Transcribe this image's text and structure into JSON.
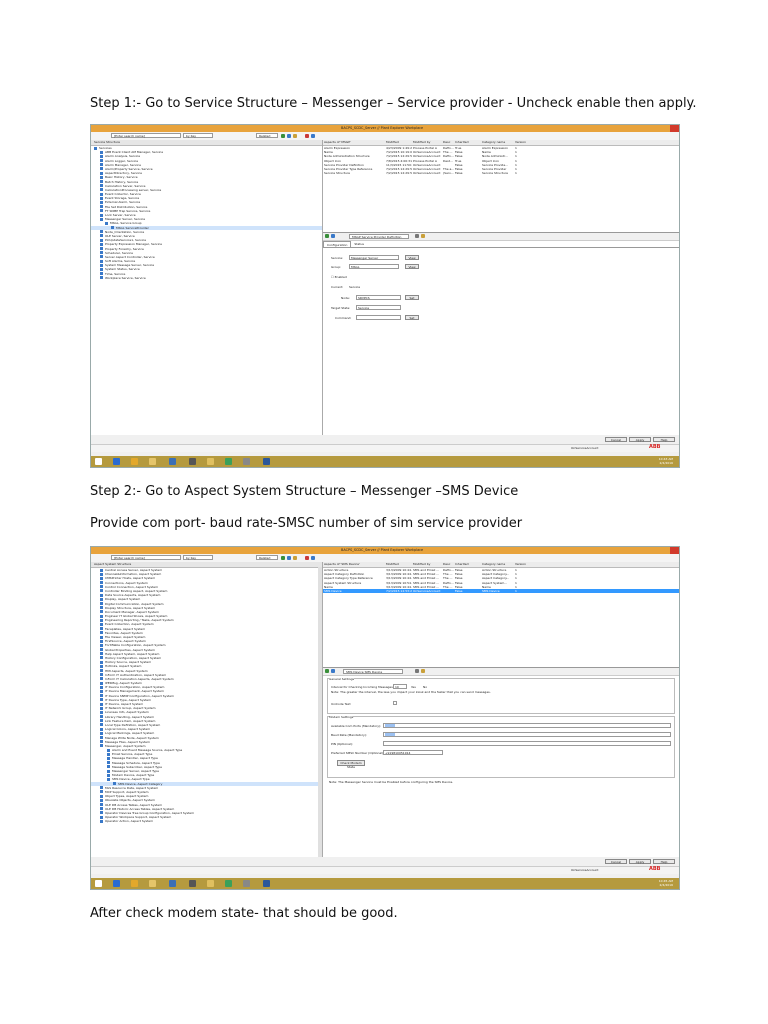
{
  "step1": "Step 1:- Go to Service Structure – Messenger – Service provider - Uncheck enable then apply.",
  "step2": "Step 2:- Go to Aspect System Structure – Messenger –SMS Device",
  "provide": "Provide com port- baud rate-SMSC number of sim service provider",
  "after": "After check modem state- that should be good.",
  "shot1": {
    "title": "BACPS_SCDC_Server // Plant Explorer Workplace",
    "search_placeholder": "[Enter search name]",
    "search_scope": "by Key",
    "filter": "Related",
    "tree_header": "Service Structure",
    "tree": [
      "Services",
      "ABB Event Client AM Manager, Service",
      "Alarm Analysis, Service",
      "Alarm Logger, Service",
      "Alarm Manager, Service",
      "Alarm/Property Service, Service",
      "AspectDirectory, Service",
      "Basic History, Service",
      "Batch History, Service",
      "Calculation Server, Service",
      "CalculationProcessing server, Service",
      "Event Collector, Service",
      "Event Storage, Service",
      "External Alarm, Service",
      "File Set Distribution, Service",
      "FT SNMP Trap Service, Service",
      "Lock Server, Service",
      "Messenger Server, Service",
      "MSGL, Service Group",
      "MSGL ServiceProvider",
      "Node_Orientation, Service",
      "OLE Server, Service",
      "PlcUpdateService1, Service",
      "Property Expression Manager, Service",
      "Property Forestry, Service",
      "Scheduler, Service",
      "Server Aspect Controller, Service",
      "Soft Alarms, Service",
      "System Message Server, Service",
      "System Status, Service",
      "Time, Service",
      "Workplace Service, Service"
    ],
    "columns": [
      "Aspects of 'MSGP'",
      "Modified",
      "Modified by",
      "Desc",
      "Inherited",
      "Category name",
      "Version"
    ],
    "rows": [
      [
        "Alarm Expression",
        "4/23/2009 1:49:2...",
        "Process Portal A",
        "Defin...",
        "True",
        "Alarm Expression",
        "1"
      ],
      [
        "Name",
        "7/2/2015 10:19:0...",
        "OnServiceAccount",
        "The ...",
        "False",
        "Name",
        "1"
      ],
      [
        "Node Administration Structure",
        "7/2/2015 12:29:5...",
        "OnServiceAccount",
        "Defin...",
        "False",
        "Node Administr...",
        "1"
      ],
      [
        "Object Icon",
        "7/8/2015 4:00:31...",
        "Process Portal A",
        "Dest...",
        "True",
        "Object Icon",
        "1"
      ],
      [
        "Service Provider Definition",
        "11/3/2015 11:50:2...",
        "OnServiceAccount",
        "",
        "False",
        "Service Provide...",
        "1"
      ],
      [
        "Service Provider Type Reference",
        "7/2/2015 12:29:5...",
        "OnServiceAccount",
        "The a...",
        "False",
        "Service Provider",
        "1"
      ],
      [
        "Service Structure",
        "7/2/2015 12:29:5...",
        "OnServiceAccount",
        "(Serv...",
        "False",
        "Service Structure",
        "1"
      ]
    ],
    "aspect_dropdown": "MSGP Service Provider Definition",
    "tabs": [
      "Configuration",
      "Status"
    ],
    "service_label": "Service:",
    "service_value": "Messenger Server",
    "group_label": "Group:",
    "group_value": "MSGL",
    "view_btn": "View",
    "enabled_label": "☐ Enabled",
    "current_label": "Current:",
    "current_value": "Service",
    "node_label": "Node:",
    "node_value": "SRVPCS",
    "target_state_label": "Target State:",
    "target_state_value": "Service",
    "command_label": "Command:",
    "set_btn": "Set",
    "footer_buttons": [
      "Cancel",
      "Apply",
      "Help"
    ],
    "status_user": "OnServiceAccount",
    "abb": "ABB",
    "clock_time": "10:43 AM",
    "clock_date": "2/4/2016"
  },
  "shot2": {
    "title": "BACPS_SCDC_Server // Plant Explorer Workplace",
    "search_placeholder": "[Enter search name]",
    "search_scope": "by Key",
    "filter": "Related",
    "tree_header": "Aspect System Structure",
    "tree": [
      "Central Access Server, Aspect System",
      "Channel&Information, Aspect System",
      "CMSPrinter Hosts, Aspect System",
      "Connections, Aspect System",
      "Control Connection, Aspect System",
      "Controller Binding Aspect, Aspect System",
      "Data Source Aspects, Aspect System",
      "Display, Aspect System",
      "Digital Communication, Aspect System",
      "Display Structure, Aspect System",
      "Document Manager, Aspect System",
      "Engineer IT Global Shows, Aspect System",
      "Engineering Reporting / Tasks, Aspect System",
      "Event Collection, Aspect System",
      "Faceplates, Aspect System",
      "Favorites, Aspect System",
      "File Viewer, Aspect System",
      "FirstSource, Aspect System",
      "Fortifiable Configuration, Aspect System",
      "Global Properties, Aspect System",
      "Help Aspect System, Aspect System",
      "History Configuration, Aspect System",
      "History Source, Aspect System",
      "Hotlinks, Aspect System",
      "HMI Aspects, Aspect System",
      "InForm IT Authentication, Aspect System",
      "InForm IT Calculation Aspects, Aspect System",
      "IPEKMsg, Aspect System",
      "IT Device Configuration, Aspect System",
      "IT Device Management, Aspect System",
      "IT Device SNMP Configuration, Aspect System",
      "IT Device Type, Aspect System",
      "IT Device, Aspect System",
      "IT Network Group, Aspect System",
      "Licenses Info, Aspect System",
      "Library Handling, Aspect System",
      "Link Feature Item, Aspect System",
      "Local Type Definition, Aspect System",
      "Logical Colors, Aspect System",
      "Logical Markings, Aspect System",
      "Manage Write Node, Aspect System",
      "Message Files, Aspect System",
      "Messenger, Aspect System",
      "Alarm and Event Message Source, Aspect Type",
      "Email Service, Aspect Type",
      "Message Handler, Aspect Type",
      "Message Schedule, Aspect Type",
      "Message Subscriber, Aspect Type",
      "Messenger Server, Aspect Type",
      "Modem Device, Aspect Type",
      "SMS Device, Aspect Type",
      "SMS Device, Aspect Category",
      "MLS Resource Data, Aspect System",
      "MCP Support, Aspect System",
      "Object Types, Aspect System",
      "Obsolete Objects, Aspect System",
      "OLE DB Access Tables, Aspect System",
      "OLE DB Historic Access Tables, Aspect System",
      "Operator Devices Tree Group Configuration, Aspect System",
      "Operator Workpace Support, Aspect System",
      "Operator Action, Aspect System"
    ],
    "tree_selected_index": 51,
    "columns": [
      "Aspects of 'SMS Device'",
      "Modified",
      "Modified by",
      "Desc",
      "Inherited",
      "Category name",
      "Version"
    ],
    "rows": [
      [
        "Action Structure",
        "3/13/2009 10:44...",
        "SMS and Email ...",
        "Defin...",
        "False",
        "Action Structure",
        "1"
      ],
      [
        "Aspect Category Definition",
        "3/13/2009 10:44...",
        "SMS and Email ...",
        "The ...",
        "False",
        "Aspect Category...",
        "1"
      ],
      [
        "Aspect Category Type Reference",
        "3/13/2009 10:44...",
        "SMS and Email ...",
        "The ...",
        "False",
        "Aspect Category...",
        "1"
      ],
      [
        "Aspect System Structure",
        "3/13/2009 10:54...",
        "SMS and Email ...",
        "Defin...",
        "False",
        "Aspect System...",
        "1"
      ],
      [
        "Name",
        "3/13/2009 10:44...",
        "SMS and Email ...",
        "The ...",
        "False",
        "Name",
        "1"
      ],
      [
        "SMS Device",
        "7/2/2015 12:53:2...",
        "OnServiceAccount",
        "",
        "False",
        "SMS Device",
        "1"
      ]
    ],
    "aspect_dropdown": "SMS Device SMS Device",
    "general_settings": "General Settings",
    "interval_label": "Interval for Checking Incoming Messages:",
    "interval_value": "10",
    "yes_label": "Yes",
    "no_label": "No",
    "note_text": "Note: The greater the interval, the less you impact your kiosk and the faster that you can send messages.",
    "unicode_label": "UniCode Text",
    "modem_settings": "Modem Settings",
    "com_port_label": "Available Com Ports (Mandatory):",
    "baud_label": "Baud Rate (Mandatory):",
    "pin_label": "PIN (Optional):",
    "smsc_label": "Preferred SMSC Number (Optional):",
    "smsc_value": "+919810051914",
    "check_modem_btn": "Check Modem State",
    "bottom_note": "Note: The Messenger Service must be Enabled before configuring the SMS Device.",
    "footer_buttons": [
      "Cancel",
      "Apply",
      "Help"
    ],
    "status_user": "OnServiceAccount",
    "abb": "ABB",
    "clock_time": "10:45 AM",
    "clock_date": "2/4/2016"
  }
}
